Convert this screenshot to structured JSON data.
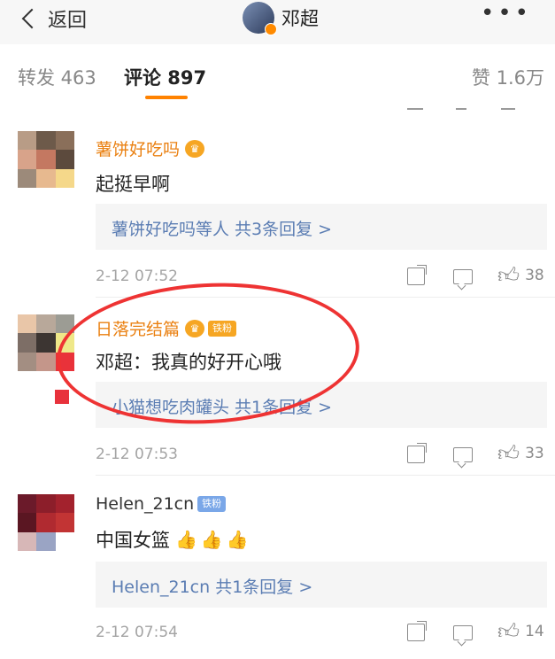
{
  "nav": {
    "back_label": "返回",
    "title": "邓超",
    "more": "•••"
  },
  "tabs": {
    "repost": "转发 463",
    "comment": "评论 897",
    "like": "赞 1.6万"
  },
  "comments": [
    {
      "username": "薯饼好吃吗",
      "badge": "",
      "text": "起挺早啊",
      "reply_link": "薯饼好吃吗等人 共3条回复 >",
      "time": "2-12 07:52",
      "likes": "38"
    },
    {
      "username": "日落完结篇",
      "badge": "铁粉",
      "text": "邓超：我真的好开心哦",
      "reply_link": "小猫想吃肉罐头 共1条回复 >",
      "time": "2-12 07:53",
      "likes": "33"
    },
    {
      "username": "Helen_21cn",
      "badge": "铁粉",
      "text": "中国女篮",
      "emoji": "👍👍👍",
      "reply_link": "Helen_21cn 共1条回复 >",
      "time": "2-12 07:54",
      "likes": "14"
    }
  ],
  "icons": [
    "back-chevron-icon",
    "share-icon",
    "comment-icon",
    "like-icon",
    "crown-icon",
    "more-icon"
  ],
  "colors": {
    "accent": "#ff8200",
    "link": "#5b7db3",
    "username": "#ea8011",
    "annotation": "#e33333"
  }
}
